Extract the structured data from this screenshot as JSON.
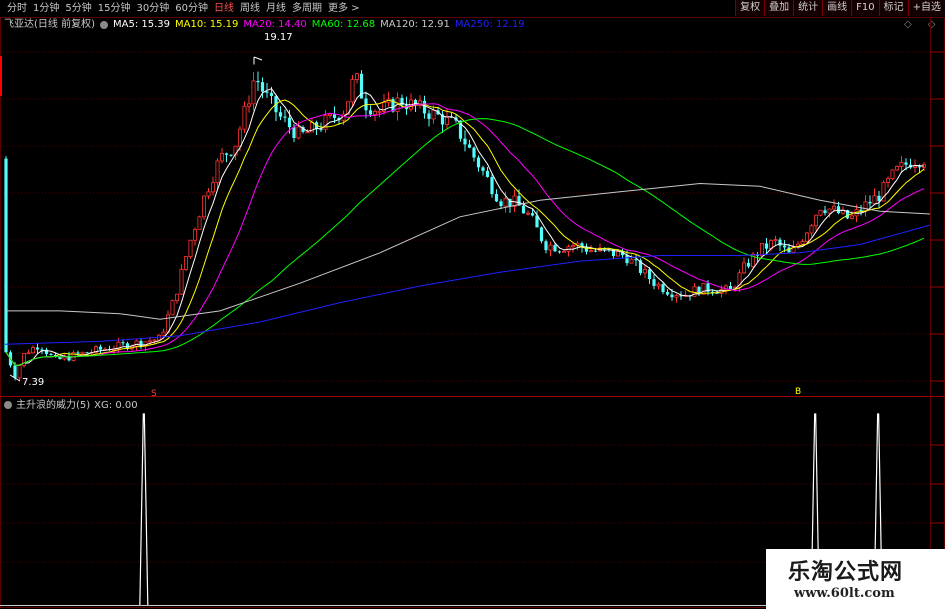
{
  "toolbar": {
    "periods": [
      "分时",
      "1分钟",
      "5分钟",
      "15分钟",
      "30分钟",
      "60分钟",
      "日线",
      "周线",
      "月线",
      "多周期",
      "更多 >"
    ],
    "active_period": "日线",
    "right_buttons": [
      "复权",
      "叠加",
      "统计",
      "画线",
      "F10",
      "标记",
      "+自选"
    ]
  },
  "main_header": {
    "title": "飞亚达(日线 前复权)",
    "ma": [
      {
        "label": "MA5: 15.39",
        "color": "#ffffff"
      },
      {
        "label": "MA10: 15.19",
        "color": "#ffff00"
      },
      {
        "label": "MA20: 14.40",
        "color": "#ff00ff"
      },
      {
        "label": "MA60: 12.68",
        "color": "#00ff00"
      },
      {
        "label": "MA120: 12.91",
        "color": "#c8c8c8"
      },
      {
        "label": "MA250: 12.19",
        "color": "#2020ff"
      }
    ],
    "top_right_icons": [
      "◇",
      "◇"
    ]
  },
  "annotations": {
    "high": "19.17",
    "low": "7.39",
    "marker_s": "S",
    "marker_b": "B"
  },
  "indicator_header": {
    "title": "主升浪的威力(5)",
    "xg": "XG: 0.00"
  },
  "watermark": {
    "title": "乐淘公式网",
    "url": "www.60lt.com"
  },
  "colors": {
    "up": "#ff3232",
    "down": "#54fcfc",
    "grid": "#5a0000",
    "spike": "#ffffff"
  },
  "chart_data": {
    "type": "candlestick",
    "price_range": [
      7.0,
      20.0
    ],
    "indicator_range": [
      0,
      1
    ],
    "signal_peaks_at": [
      0.151,
      0.876,
      0.944
    ]
  }
}
